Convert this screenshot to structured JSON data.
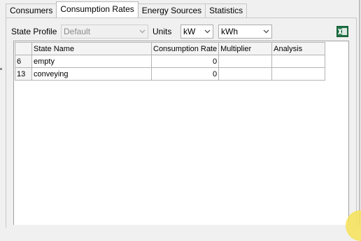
{
  "tabs": [
    "Consumers",
    "Consumption Rates",
    "Energy Sources",
    "Statistics"
  ],
  "active_tab": "Consumption Rates",
  "toolbar": {
    "state_profile_label": "State Profile",
    "state_profile_value": "Default",
    "units_label": "Units",
    "power_unit": "kW",
    "energy_unit": "kWh"
  },
  "grid": {
    "columns": [
      "",
      "State Name",
      "Consumption Rate",
      "Multiplier",
      "Analysis"
    ],
    "rows": [
      {
        "id": "6",
        "state_name": "empty",
        "rate": "0",
        "multiplier": "",
        "analysis": ""
      },
      {
        "id": "13",
        "state_name": "conveying",
        "rate": "0",
        "multiplier": "",
        "analysis": ""
      }
    ]
  },
  "colors": {
    "excel_green": "#1e7145",
    "cursor_highlight": "#f6e256"
  },
  "icons": {
    "export": "excel-export-icon",
    "dropdown": "chevron-down-icon"
  }
}
